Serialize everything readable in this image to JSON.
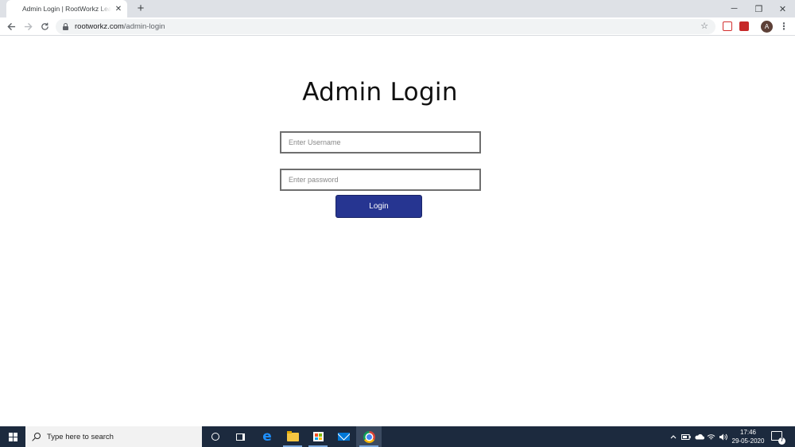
{
  "browser": {
    "tab_title": "Admin Login | RootWorkz Learning",
    "tab_close_glyph": "✕",
    "new_tab_glyph": "+",
    "url_host": "rootworkz.com",
    "url_path": "/admin-login",
    "avatar_letter": "A",
    "window_controls": [
      "─",
      "❐",
      "✕"
    ]
  },
  "page": {
    "heading": "Admin Login",
    "username_placeholder": "Enter Username",
    "password_placeholder": "Enter password",
    "login_label": "Login",
    "login_button_color": "#263591"
  },
  "taskbar": {
    "search_placeholder": "Type here to search",
    "time": "17:46",
    "date": "29-05-2020",
    "notification_count": "7"
  },
  "icons": [
    "back-arrow-icon",
    "forward-arrow-icon",
    "reload-icon",
    "lock-icon",
    "bookmark-star-icon",
    "windows-start-icon",
    "search-icon",
    "cortana-icon",
    "task-view-icon",
    "edge-icon",
    "file-explorer-icon",
    "store-icon",
    "mail-icon",
    "chrome-icon"
  ]
}
